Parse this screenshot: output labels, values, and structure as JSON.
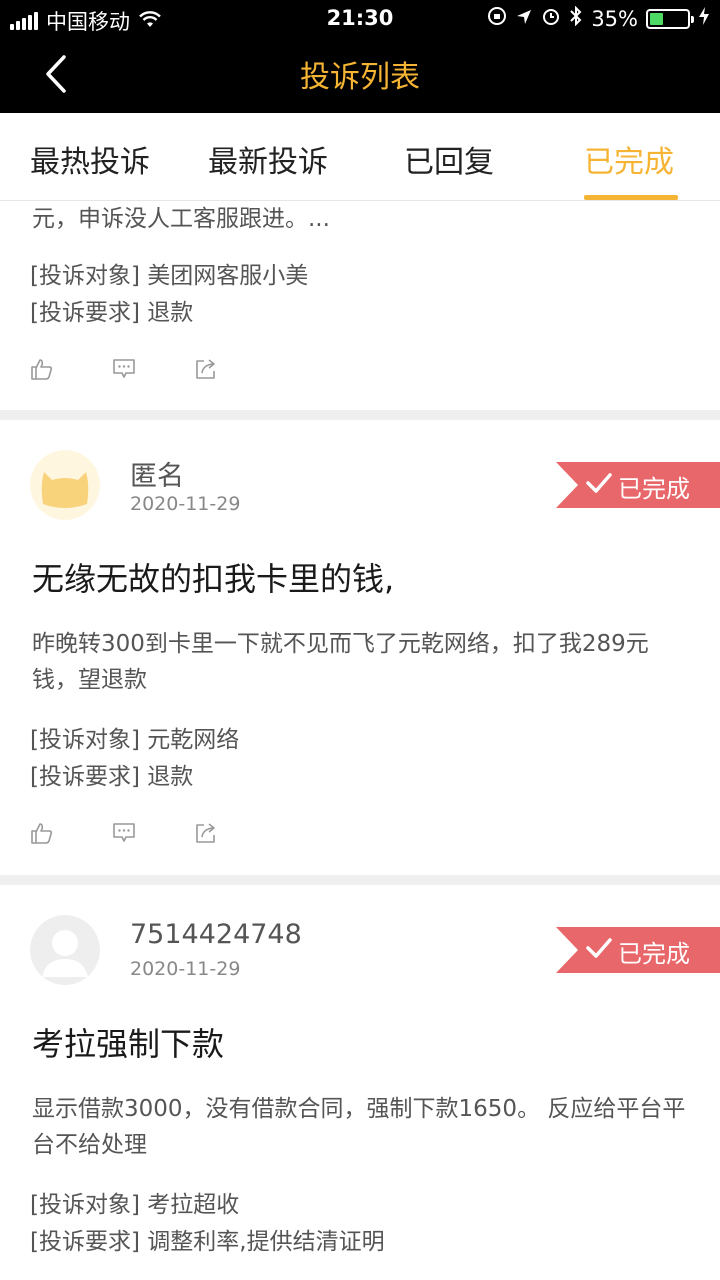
{
  "status": {
    "carrier": "中国移动",
    "time": "21:30",
    "battery": "35%",
    "battery_level": 0.35
  },
  "header": {
    "title": "投诉列表"
  },
  "tabs": [
    {
      "label": "最热投诉"
    },
    {
      "label": "最新投诉"
    },
    {
      "label": "已回复"
    },
    {
      "label": "已完成"
    }
  ],
  "cards": [
    {
      "body": "元，申诉没人工客服跟进。...",
      "target_label": "[投诉对象]",
      "target": "美团网客服小美",
      "demand_label": "[投诉要求]",
      "demand": "退款"
    },
    {
      "user": "匿名",
      "date": "2020-11-29",
      "badge": "已完成",
      "title": "无缘无故的扣我卡里的钱,",
      "body": "昨晚转300到卡里一下就不见而飞了元乾网络，扣了我289元钱，望退款",
      "target_label": "[投诉对象]",
      "target": "元乾网络",
      "demand_label": "[投诉要求]",
      "demand": "退款"
    },
    {
      "user": "7514424748",
      "date": "2020-11-29",
      "badge": "已完成",
      "title": "考拉强制下款",
      "body": "显示借款3000，没有借款合同，强制下款1650。 反应给平台平台不给处理",
      "target_label": "[投诉对象]",
      "target": "考拉超收",
      "demand_label": "[投诉要求]",
      "demand": "调整利率,提供结清证明"
    }
  ],
  "colors": {
    "accent": "#f5b433",
    "badge": "#e8676a",
    "header_bg": "#000000"
  }
}
